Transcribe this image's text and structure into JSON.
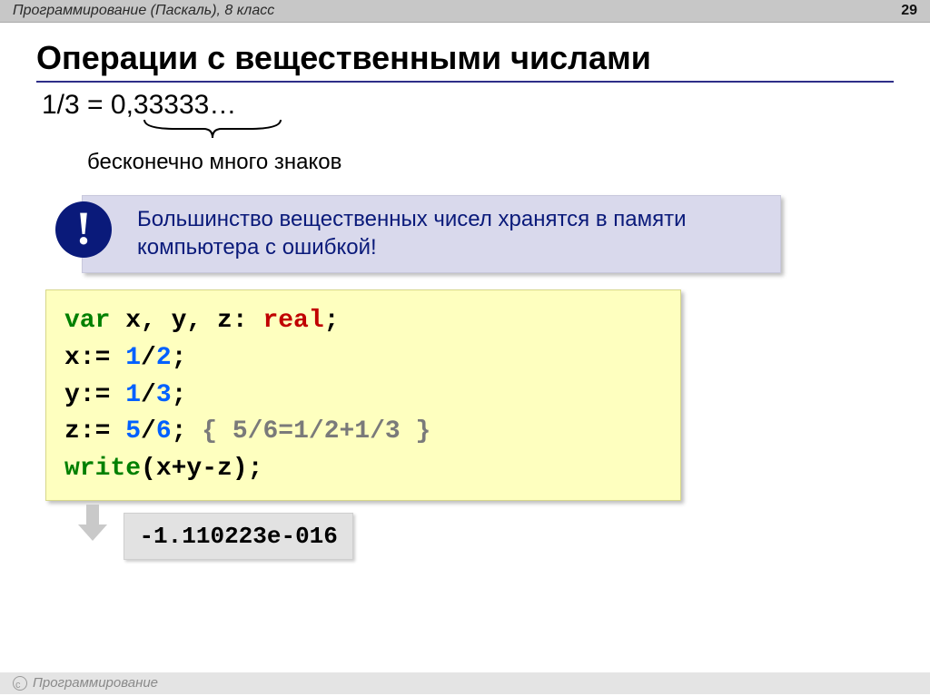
{
  "header": {
    "breadcrumb": "Программирование (Паскаль), 8 класс",
    "page_number": "29"
  },
  "title": "Операции с вещественными числами",
  "fraction": {
    "expression": "1/3 = 0,33333…",
    "caption": "бесконечно много знаков"
  },
  "callout": {
    "badge": "!",
    "text": "Большинство вещественных чисел хранятся в памяти компьютера с ошибкой!"
  },
  "code": {
    "kw_var": "var",
    "decl_rest": " x, y, z: ",
    "kw_real": "real",
    "semicolon": ";",
    "l2_a": "x:= ",
    "l2_n1": "1",
    "l2_s": "/",
    "l2_n2": "2",
    "l2_e": ";",
    "l3_a": "y:= ",
    "l3_n1": "1",
    "l3_s": "/",
    "l3_n2": "3",
    "l3_e": ";",
    "l4_a": "z:= ",
    "l4_n1": "5",
    "l4_s": "/",
    "l4_n2": "6",
    "l4_e": ";   ",
    "l4_comment": "{ 5/6=1/2+1/3 }",
    "l5_w": "write",
    "l5_rest": "(x+y-z);"
  },
  "output": "-1.110223e-016",
  "footer": "Программирование"
}
